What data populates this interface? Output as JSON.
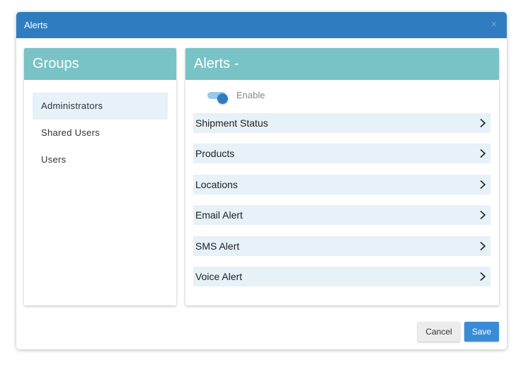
{
  "dialog": {
    "title": "Alerts",
    "close_icon": "×",
    "colors": {
      "header": "#2f7dc0",
      "panel_header": "#79c3c6",
      "row_highlight": "#e6f1f8",
      "primary": "#3a8cd6"
    }
  },
  "groups": {
    "title": "Groups",
    "selected": "Administrators",
    "items": [
      "Administrators",
      "Shared Users",
      "Users"
    ]
  },
  "alerts": {
    "title": "Alerts -",
    "enable": {
      "label": "Enable",
      "on": true
    },
    "sections": [
      {
        "label": "Shipment Status",
        "icon": "chevron-right-icon"
      },
      {
        "label": "Products",
        "icon": "chevron-right-icon"
      },
      {
        "label": "Locations",
        "icon": "chevron-right-icon"
      },
      {
        "label": "Email Alert",
        "icon": "chevron-right-icon"
      },
      {
        "label": "SMS Alert",
        "icon": "chevron-right-icon"
      },
      {
        "label": "Voice Alert",
        "icon": "chevron-right-icon"
      }
    ]
  },
  "footer": {
    "cancel_label": "Cancel",
    "save_label": "Save"
  }
}
